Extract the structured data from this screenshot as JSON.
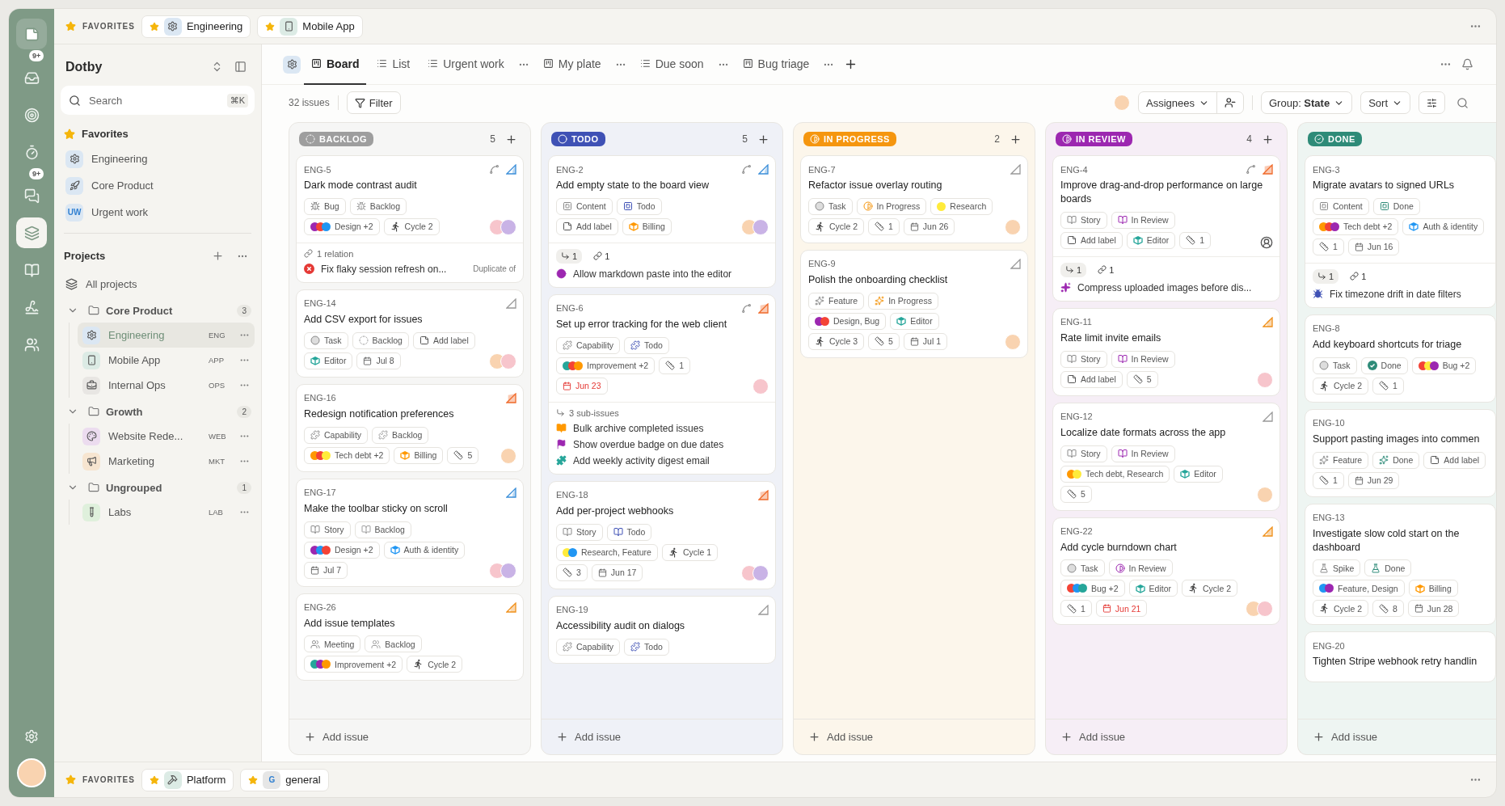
{
  "rail": {
    "items": [
      {
        "kind": "inbox",
        "selected": false,
        "badge": "9+"
      },
      {
        "kind": "target",
        "selected": false
      },
      {
        "kind": "timer",
        "selected": false
      },
      {
        "kind": "chat",
        "selected": false,
        "badge": "9+"
      },
      {
        "kind": "layers",
        "selected": true
      },
      {
        "kind": "book",
        "selected": false
      },
      {
        "kind": "signature",
        "selected": false
      },
      {
        "kind": "people",
        "selected": false
      }
    ]
  },
  "favorites_bar": {
    "label": "FAVORITES",
    "items": [
      {
        "kind": "gear",
        "color": "#dbe7f3",
        "text": "Engineering"
      },
      {
        "kind": "phone",
        "color": "#dcebe5",
        "text": "Mobile App"
      }
    ]
  },
  "sidebar": {
    "workspace": "Dotby",
    "search": {
      "placeholder": "Search",
      "shortcut": "⌘K"
    },
    "favorites": {
      "title": "Favorites",
      "items": [
        {
          "kind": "gear",
          "color": "#dbe7f3",
          "name": "Engineering"
        },
        {
          "kind": "rocket",
          "color": "#dbe7f3",
          "name": "Core Product"
        },
        {
          "kind": "letters",
          "color": "#dbe7f3",
          "tile_text": "UW",
          "name": "Urgent work"
        }
      ]
    },
    "projects": {
      "title": "Projects",
      "all": "All projects",
      "groups": [
        {
          "name": "Core Product",
          "count": "3",
          "expanded": true,
          "children": [
            {
              "kind": "gear",
              "color": "#dbe7f3",
              "name": "Engineering",
              "code": "ENG",
              "selected": true
            },
            {
              "kind": "phone",
              "color": "#dcebe5",
              "name": "Mobile App",
              "code": "APP",
              "selected": false
            },
            {
              "kind": "toolbox",
              "color": "#e8e6e3",
              "name": "Internal Ops",
              "code": "OPS",
              "selected": false
            }
          ]
        },
        {
          "name": "Growth",
          "count": "2",
          "expanded": true,
          "children": [
            {
              "kind": "palette",
              "color": "#ecdcef",
              "name": "Website Rede...",
              "code": "WEB",
              "selected": false
            },
            {
              "kind": "megaphone",
              "color": "#f7e5d0",
              "name": "Marketing",
              "code": "MKT",
              "selected": false
            }
          ]
        },
        {
          "name": "Ungrouped",
          "count": "1",
          "expanded": true,
          "children": [
            {
              "kind": "tube",
              "color": "#dff0dc",
              "name": "Labs",
              "code": "LAB",
              "selected": false
            }
          ]
        }
      ]
    }
  },
  "view": {
    "project_icon": {
      "kind": "gear",
      "color": "#dbe7f3"
    },
    "tabs": [
      {
        "kind": "board",
        "label": "Board",
        "selected": true,
        "menu": false
      },
      {
        "kind": "list",
        "label": "List",
        "selected": false,
        "menu": false
      },
      {
        "kind": "list",
        "label": "Urgent work",
        "selected": false,
        "menu": true
      },
      {
        "kind": "board",
        "label": "My plate",
        "selected": false,
        "menu": true
      },
      {
        "kind": "list",
        "label": "Due soon",
        "selected": false,
        "menu": true
      },
      {
        "kind": "board",
        "label": "Bug triage",
        "selected": false,
        "menu": true
      }
    ]
  },
  "toolbar": {
    "issue_count": "32 issues",
    "filter": "Filter",
    "assignees": "Assignees",
    "group": "Group: **State**",
    "sort": "Sort"
  },
  "board": {
    "columns": [
      {
        "name": "BACKLOG",
        "kind": "backlog",
        "color": "#9e9e9e",
        "count": "5",
        "add": "Add issue",
        "cards": [
          {
            "id": "ENG-5",
            "title": "Dark mode contrast audit",
            "branch": true,
            "priority": {
              "kind": "low"
            },
            "rows": [
              {
                "chips": [
                  {
                    "kind": "bug",
                    "text": "Bug",
                    "state": false
                  },
                  {
                    "kind": "bug",
                    "text": "Backlog",
                    "state": true
                  }
                ]
              },
              {
                "chips": [
                  {
                    "kind": "labels",
                    "text": "Design +2",
                    "dots": [
                      {
                        "color": "#9c27b0"
                      },
                      {
                        "color": "#f44336"
                      },
                      {
                        "color": "#2196f3"
                      }
                    ]
                  },
                  {
                    "kind": "cycle",
                    "text": "Cycle 2"
                  }
                ]
              }
            ],
            "avatars": [
              {
                "color": "#f7c5cc"
              },
              {
                "color": "#c9b3e6"
              }
            ],
            "footer": {
              "kind": "relations",
              "header": "1 relation",
              "items": [
                {
                  "kind": "error",
                  "color": "#e53935",
                  "text": "Fix flaky session refresh on...",
                  "note": "Duplicate of"
                }
              ]
            }
          },
          {
            "id": "ENG-14",
            "title": "Add CSV export for issues",
            "priority": {
              "kind": "none"
            },
            "rows": [
              {
                "chips": [
                  {
                    "kind": "task",
                    "text": "Task",
                    "state": false
                  },
                  {
                    "kind": "backlog",
                    "text": "Backlog",
                    "state": true
                  },
                  {
                    "kind": "add-label",
                    "text": "Add label"
                  }
                ]
              },
              {
                "chips": [
                  {
                    "kind": "project",
                    "text": "Editor",
                    "color": "#26a69a"
                  },
                  {
                    "kind": "date",
                    "text": "Jul 8",
                    "overdue": false
                  }
                ]
              }
            ],
            "avatars": [
              {
                "color": "#f9d3b0"
              },
              {
                "color": "#f7c5cc"
              }
            ]
          },
          {
            "id": "ENG-16",
            "title": "Redesign notification preferences",
            "priority": {
              "kind": "high"
            },
            "rows": [
              {
                "chips": [
                  {
                    "kind": "capability",
                    "text": "Capability",
                    "state": false
                  },
                  {
                    "kind": "capability",
                    "text": "Backlog",
                    "state": true
                  }
                ]
              },
              {
                "chips": [
                  {
                    "kind": "labels",
                    "text": "Tech debt +2",
                    "dots": [
                      {
                        "color": "#ff9800"
                      },
                      {
                        "color": "#f44336"
                      },
                      {
                        "color": "#ffeb3b"
                      }
                    ]
                  },
                  {
                    "kind": "project",
                    "text": "Billing",
                    "color": "#ff9800"
                  },
                  {
                    "kind": "estimate",
                    "text": "5"
                  }
                ]
              }
            ],
            "avatars": [
              {
                "color": "#f9d3b0"
              }
            ]
          },
          {
            "id": "ENG-17",
            "title": "Make the toolbar sticky on scroll",
            "priority": {
              "kind": "low"
            },
            "rows": [
              {
                "chips": [
                  {
                    "kind": "story",
                    "text": "Story",
                    "state": false
                  },
                  {
                    "kind": "story",
                    "text": "Backlog",
                    "state": true
                  }
                ]
              },
              {
                "chips": [
                  {
                    "kind": "labels",
                    "text": "Design +2",
                    "dots": [
                      {
                        "color": "#9c27b0"
                      },
                      {
                        "color": "#2196f3"
                      },
                      {
                        "color": "#f44336"
                      }
                    ]
                  },
                  {
                    "kind": "project",
                    "text": "Auth & identity",
                    "color": "#2196f3"
                  }
                ]
              },
              {
                "chips": [
                  {
                    "kind": "date",
                    "text": "Jul 7",
                    "overdue": false
                  }
                ]
              }
            ],
            "avatars": [
              {
                "color": "#f7c5cc"
              },
              {
                "color": "#c9b3e6"
              }
            ]
          },
          {
            "id": "ENG-26",
            "title": "Add issue templates",
            "priority": {
              "kind": "medium"
            },
            "rows": [
              {
                "chips": [
                  {
                    "kind": "meeting",
                    "text": "Meeting",
                    "state": false
                  },
                  {
                    "kind": "meeting",
                    "text": "Backlog",
                    "state": true
                  }
                ]
              },
              {
                "chips": [
                  {
                    "kind": "labels",
                    "text": "Improvement +2",
                    "dots": [
                      {
                        "color": "#26a69a"
                      },
                      {
                        "color": "#9c27b0"
                      },
                      {
                        "color": "#ff9800"
                      }
                    ]
                  },
                  {
                    "kind": "cycle",
                    "text": "Cycle 2"
                  }
                ]
              }
            ]
          }
        ]
      },
      {
        "name": "TODO",
        "kind": "todo",
        "color": "#3f51b5",
        "count": "5",
        "add": "Add issue",
        "cards": [
          {
            "id": "ENG-2",
            "title": "Add empty state to the board view",
            "branch": true,
            "priority": {
              "kind": "low"
            },
            "rows": [
              {
                "chips": [
                  {
                    "kind": "content",
                    "text": "Content",
                    "state": false
                  },
                  {
                    "kind": "content",
                    "text": "Todo",
                    "state": true
                  }
                ]
              },
              {
                "chips": [
                  {
                    "kind": "add-label",
                    "text": "Add label"
                  },
                  {
                    "kind": "project",
                    "text": "Billing",
                    "color": "#ff9800"
                  }
                ]
              }
            ],
            "avatars": [
              {
                "color": "#f9d3b0"
              },
              {
                "color": "#c9b3e6"
              }
            ],
            "footer": {
              "kind": "counts",
              "sub": "1",
              "links": "1",
              "items": [
                {
                  "kind": "in-review",
                  "color": "#9c27b0",
                  "text": "Allow markdown paste into the editor"
                }
              ]
            }
          },
          {
            "id": "ENG-6",
            "title": "Set up error tracking for the web client",
            "branch": true,
            "priority": {
              "kind": "high"
            },
            "rows": [
              {
                "chips": [
                  {
                    "kind": "capability",
                    "text": "Capability",
                    "state": false
                  },
                  {
                    "kind": "capability",
                    "text": "Todo",
                    "state": true
                  }
                ]
              },
              {
                "chips": [
                  {
                    "kind": "labels",
                    "text": "Improvement +2",
                    "dots": [
                      {
                        "color": "#26a69a"
                      },
                      {
                        "color": "#f44336"
                      },
                      {
                        "color": "#ff9800"
                      }
                    ]
                  },
                  {
                    "kind": "estimate",
                    "text": "1"
                  }
                ]
              },
              {
                "chips": [
                  {
                    "kind": "date",
                    "text": "Jun 23",
                    "overdue": true
                  }
                ]
              }
            ],
            "avatars": [
              {
                "color": "#f7c5cc"
              }
            ],
            "footer": {
              "kind": "sub-issues",
              "header": "3 sub-issues",
              "items": [
                {
                  "kind": "story",
                  "color": "#ff9800",
                  "text": "Bulk archive completed issues"
                },
                {
                  "kind": "flag",
                  "color": "#9c27b0",
                  "text": "Show overdue badge on due dates"
                },
                {
                  "kind": "capability",
                  "color": "#26a69a",
                  "text": "Add weekly activity digest email"
                }
              ]
            }
          },
          {
            "id": "ENG-18",
            "title": "Add per-project webhooks",
            "priority": {
              "kind": "high"
            },
            "rows": [
              {
                "chips": [
                  {
                    "kind": "story",
                    "text": "Story",
                    "state": false
                  },
                  {
                    "kind": "story",
                    "text": "Todo",
                    "state": true
                  }
                ]
              },
              {
                "chips": [
                  {
                    "kind": "labels",
                    "text": "Research, Feature",
                    "dots": [
                      {
                        "color": "#ffeb3b"
                      },
                      {
                        "color": "#2196f3"
                      }
                    ]
                  },
                  {
                    "kind": "cycle",
                    "text": "Cycle 1"
                  }
                ]
              },
              {
                "chips": [
                  {
                    "kind": "estimate",
                    "text": "3"
                  },
                  {
                    "kind": "date",
                    "text": "Jun 17",
                    "overdue": false
                  }
                ]
              }
            ],
            "avatars": [
              {
                "color": "#f7c5cc"
              },
              {
                "color": "#c9b3e6"
              }
            ]
          },
          {
            "id": "ENG-19",
            "title": "Accessibility audit on dialogs",
            "priority": {
              "kind": "none"
            },
            "rows": [
              {
                "chips": [
                  {
                    "kind": "capability",
                    "text": "Capability",
                    "state": false
                  },
                  {
                    "kind": "capability",
                    "text": "Todo",
                    "state": true
                  }
                ]
              }
            ]
          }
        ]
      },
      {
        "name": "IN PROGRESS",
        "kind": "in-progress",
        "color": "#f5960f",
        "count": "2",
        "add": "Add issue",
        "cards": [
          {
            "id": "ENG-7",
            "title": "Refactor issue overlay routing",
            "priority": {
              "kind": "none"
            },
            "rows": [
              {
                "chips": [
                  {
                    "kind": "task",
                    "text": "Task",
                    "state": false
                  },
                  {
                    "kind": "in-progress",
                    "text": "In Progress",
                    "state": true
                  },
                  {
                    "kind": "labels",
                    "text": "Research",
                    "dots": [
                      {
                        "color": "#ffeb3b"
                      }
                    ]
                  }
                ]
              },
              {
                "chips": [
                  {
                    "kind": "cycle",
                    "text": "Cycle 2"
                  },
                  {
                    "kind": "estimate",
                    "text": "1"
                  },
                  {
                    "kind": "date",
                    "text": "Jun 26",
                    "overdue": false
                  }
                ]
              }
            ],
            "avatars": [
              {
                "color": "#f9d3b0"
              }
            ]
          },
          {
            "id": "ENG-9",
            "title": "Polish the onboarding checklist",
            "priority": {
              "kind": "none"
            },
            "rows": [
              {
                "chips": [
                  {
                    "kind": "feature",
                    "text": "Feature",
                    "state": false
                  },
                  {
                    "kind": "feature",
                    "text": "In Progress",
                    "state": true
                  }
                ]
              },
              {
                "chips": [
                  {
                    "kind": "labels",
                    "text": "Design, Bug",
                    "dots": [
                      {
                        "color": "#9c27b0"
                      },
                      {
                        "color": "#f44336"
                      }
                    ]
                  },
                  {
                    "kind": "project",
                    "text": "Editor",
                    "color": "#26a69a"
                  }
                ]
              },
              {
                "chips": [
                  {
                    "kind": "cycle",
                    "text": "Cycle 3"
                  },
                  {
                    "kind": "estimate",
                    "text": "5"
                  },
                  {
                    "kind": "date",
                    "text": "Jul 1",
                    "overdue": false
                  }
                ]
              }
            ],
            "avatars": [
              {
                "color": "#f9d3b0"
              }
            ]
          }
        ]
      },
      {
        "name": "IN REVIEW",
        "kind": "in-review",
        "color": "#9c27b0",
        "count": "4",
        "add": "Add issue",
        "cards": [
          {
            "id": "ENG-4",
            "title": "Improve drag-and-drop performance on large boards",
            "branch": true,
            "priority": {
              "kind": "high"
            },
            "unassigned": true,
            "rows": [
              {
                "chips": [
                  {
                    "kind": "story",
                    "text": "Story",
                    "state": false
                  },
                  {
                    "kind": "story",
                    "text": "In Review",
                    "state": true
                  }
                ]
              },
              {
                "chips": [
                  {
                    "kind": "add-label",
                    "text": "Add label"
                  },
                  {
                    "kind": "project",
                    "text": "Editor",
                    "color": "#26a69a"
                  },
                  {
                    "kind": "estimate",
                    "text": "1"
                  }
                ]
              }
            ],
            "footer": {
              "kind": "counts",
              "sub": "1",
              "links": "1",
              "items": [
                {
                  "kind": "feature",
                  "color": "#9c27b0",
                  "text": "Compress uploaded images before dis..."
                }
              ]
            }
          },
          {
            "id": "ENG-11",
            "title": "Rate limit invite emails",
            "priority": {
              "kind": "medium"
            },
            "rows": [
              {
                "chips": [
                  {
                    "kind": "story",
                    "text": "Story",
                    "state": false
                  },
                  {
                    "kind": "story",
                    "text": "In Review",
                    "state": true
                  }
                ]
              },
              {
                "chips": [
                  {
                    "kind": "add-label",
                    "text": "Add label"
                  },
                  {
                    "kind": "estimate",
                    "text": "5"
                  }
                ]
              }
            ],
            "avatars": [
              {
                "color": "#f7c5cc"
              }
            ]
          },
          {
            "id": "ENG-12",
            "title": "Localize date formats across the app",
            "priority": {
              "kind": "none"
            },
            "rows": [
              {
                "chips": [
                  {
                    "kind": "story",
                    "text": "Story",
                    "state": false
                  },
                  {
                    "kind": "story",
                    "text": "In Review",
                    "state": true
                  }
                ]
              },
              {
                "chips": [
                  {
                    "kind": "labels",
                    "text": "Tech debt, Research",
                    "dots": [
                      {
                        "color": "#ff9800"
                      },
                      {
                        "color": "#ffeb3b"
                      }
                    ]
                  },
                  {
                    "kind": "project",
                    "text": "Editor",
                    "color": "#26a69a"
                  }
                ]
              },
              {
                "chips": [
                  {
                    "kind": "estimate",
                    "text": "5"
                  }
                ]
              }
            ],
            "avatars": [
              {
                "color": "#f9d3b0"
              }
            ]
          },
          {
            "id": "ENG-22",
            "title": "Add cycle burndown chart",
            "priority": {
              "kind": "medium"
            },
            "rows": [
              {
                "chips": [
                  {
                    "kind": "task",
                    "text": "Task",
                    "state": false
                  },
                  {
                    "kind": "in-review",
                    "text": "In Review",
                    "state": true
                  }
                ]
              },
              {
                "chips": [
                  {
                    "kind": "labels",
                    "text": "Bug +2",
                    "dots": [
                      {
                        "color": "#f44336"
                      },
                      {
                        "color": "#2196f3"
                      },
                      {
                        "color": "#26a69a"
                      }
                    ]
                  },
                  {
                    "kind": "project",
                    "text": "Editor",
                    "color": "#26a69a"
                  },
                  {
                    "kind": "cycle",
                    "text": "Cycle 2"
                  }
                ]
              },
              {
                "chips": [
                  {
                    "kind": "estimate",
                    "text": "1"
                  },
                  {
                    "kind": "date",
                    "text": "Jun 21",
                    "overdue": true
                  }
                ]
              }
            ],
            "avatars": [
              {
                "color": "#f9d3b0"
              },
              {
                "color": "#f7c5cc"
              }
            ]
          }
        ]
      },
      {
        "name": "DONE",
        "kind": "done",
        "color": "#2e8b78",
        "add": "Add issue",
        "cards": [
          {
            "id": "ENG-3",
            "title": "Migrate avatars to signed URLs",
            "rows": [
              {
                "chips": [
                  {
                    "kind": "content",
                    "text": "Content",
                    "state": false
                  },
                  {
                    "kind": "content",
                    "text": "Done",
                    "state": true
                  }
                ]
              },
              {
                "chips": [
                  {
                    "kind": "labels",
                    "text": "Tech debt +2",
                    "dots": [
                      {
                        "color": "#ff9800"
                      },
                      {
                        "color": "#f44336"
                      },
                      {
                        "color": "#9c27b0"
                      }
                    ]
                  },
                  {
                    "kind": "project",
                    "text": "Auth & identity",
                    "color": "#2196f3"
                  }
                ]
              },
              {
                "chips": [
                  {
                    "kind": "estimate",
                    "text": "1"
                  },
                  {
                    "kind": "date",
                    "text": "Jun 16",
                    "overdue": false
                  }
                ]
              }
            ],
            "footer": {
              "kind": "counts",
              "sub": "1",
              "links": "1",
              "items": [
                {
                  "kind": "bug",
                  "color": "#3f51b5",
                  "text": "Fix timezone drift in date filters"
                }
              ]
            }
          },
          {
            "id": "ENG-8",
            "title": "Add keyboard shortcuts for triage",
            "rows": [
              {
                "chips": [
                  {
                    "kind": "task",
                    "text": "Task",
                    "state": false
                  },
                  {
                    "kind": "done",
                    "text": "Done",
                    "state": true
                  },
                  {
                    "kind": "labels",
                    "text": "Bug +2",
                    "dots": [
                      {
                        "color": "#f44336"
                      },
                      {
                        "color": "#ffeb3b"
                      },
                      {
                        "color": "#9c27b0"
                      }
                    ]
                  }
                ]
              },
              {
                "chips": [
                  {
                    "kind": "cycle",
                    "text": "Cycle 2"
                  },
                  {
                    "kind": "estimate",
                    "text": "1"
                  }
                ]
              }
            ]
          },
          {
            "id": "ENG-10",
            "title": "Support pasting images into commen",
            "rows": [
              {
                "chips": [
                  {
                    "kind": "feature",
                    "text": "Feature",
                    "state": false
                  },
                  {
                    "kind": "feature",
                    "text": "Done",
                    "state": true
                  },
                  {
                    "kind": "add-label",
                    "text": "Add label"
                  }
                ]
              },
              {
                "chips": [
                  {
                    "kind": "estimate",
                    "text": "1"
                  },
                  {
                    "kind": "date",
                    "text": "Jun 29",
                    "overdue": false
                  }
                ]
              }
            ]
          },
          {
            "id": "ENG-13",
            "title": "Investigate slow cold start on the dashboard",
            "rows": [
              {
                "chips": [
                  {
                    "kind": "spike",
                    "text": "Spike",
                    "state": false
                  },
                  {
                    "kind": "spike",
                    "text": "Done",
                    "state": true
                  }
                ]
              },
              {
                "chips": [
                  {
                    "kind": "labels",
                    "text": "Feature, Design",
                    "dots": [
                      {
                        "color": "#2196f3"
                      },
                      {
                        "color": "#9c27b0"
                      }
                    ]
                  },
                  {
                    "kind": "project",
                    "text": "Billing",
                    "color": "#ff9800"
                  }
                ]
              },
              {
                "chips": [
                  {
                    "kind": "cycle",
                    "text": "Cycle 2"
                  },
                  {
                    "kind": "estimate",
                    "text": "8"
                  },
                  {
                    "kind": "date",
                    "text": "Jun 28",
                    "overdue": false
                  }
                ]
              }
            ]
          },
          {
            "id": "ENG-20",
            "title": "Tighten Stripe webhook retry handlin"
          }
        ]
      }
    ]
  },
  "bottom_bar": {
    "label": "FAVORITES",
    "items": [
      {
        "kind": "hammer",
        "color": "#dcebe5",
        "text": "Platform"
      },
      {
        "kind": "letters",
        "color": "#e6e6e6",
        "tile_text": "G",
        "text": "general"
      }
    ]
  }
}
